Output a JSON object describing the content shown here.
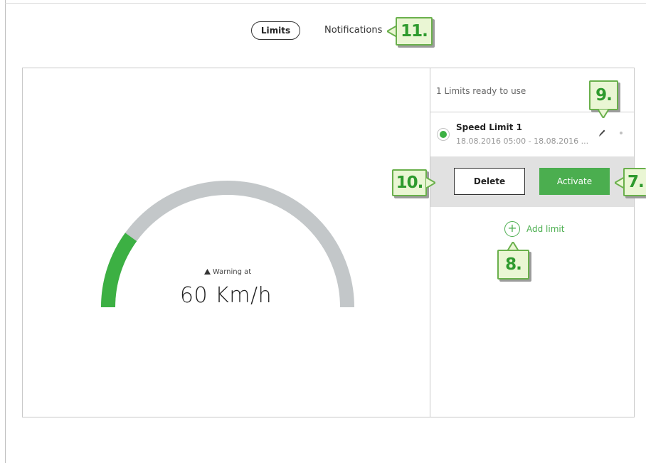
{
  "tabs": {
    "limits": "Limits",
    "notifications": "Notifications"
  },
  "callouts": {
    "c7": "7.",
    "c8": "8.",
    "c9": "9.",
    "c10": "10.",
    "c11": "11."
  },
  "gauge": {
    "warning_label": "Warning at",
    "warning_icon": "warning-triangle-icon",
    "speed_value": "60 Km/h",
    "fill_fraction": 0.2,
    "fill_color": "#3cb043",
    "track_color": "#c3c7c9"
  },
  "limits_panel": {
    "ready_text": "1 Limits ready to use",
    "items": [
      {
        "name": "Speed Limit 1",
        "dates": "18.08.2016 05:00 - 18.08.2016 ...",
        "selected": true
      }
    ],
    "delete_label": "Delete",
    "activate_label": "Activate",
    "add_icon": "+",
    "add_label": "Add limit"
  },
  "colors": {
    "accent": "#4bae4f",
    "callout_bg": "#eaf6d4",
    "callout_text": "#2e9a2e"
  }
}
